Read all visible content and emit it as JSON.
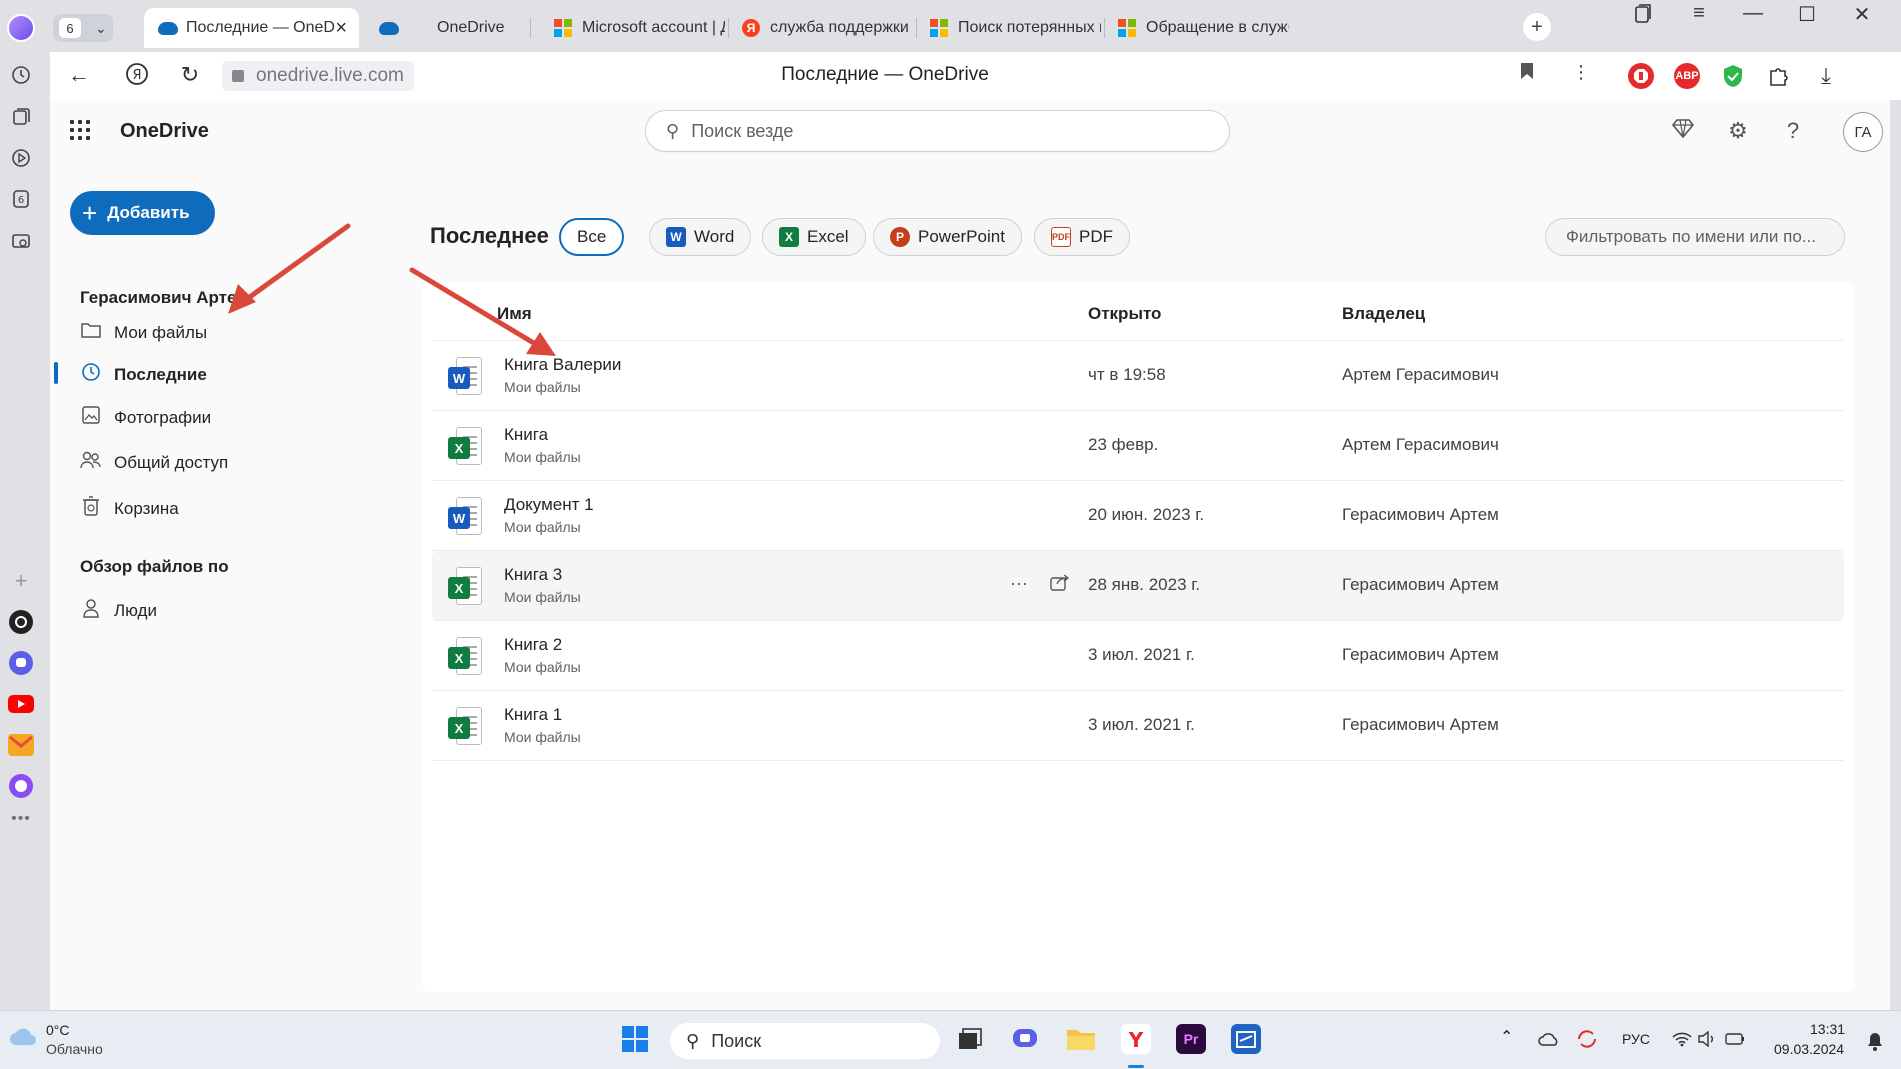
{
  "browser": {
    "tab_count": "6",
    "tabs": [
      {
        "title": "Последние — OneD",
        "favicon": "onedrive-icon"
      },
      {
        "title": "OneDrive",
        "favicon": "onedrive-icon"
      },
      {
        "title": "Microsoft account | Дом",
        "favicon": "microsoft-logo"
      },
      {
        "title": "служба поддержки On",
        "favicon": "yandex-icon"
      },
      {
        "title": "Поиск потерянных или",
        "favicon": "microsoft-logo"
      },
      {
        "title": "Обращение в службу п",
        "favicon": "microsoft-logo"
      }
    ],
    "url": "onedrive.live.com",
    "page_title": "Последние — OneDrive",
    "extensions": {
      "abp": "ABP"
    }
  },
  "app": {
    "brand": "OneDrive",
    "search_placeholder": "Поиск везде",
    "user_initials": "ГА"
  },
  "nav": {
    "add_label": "Добавить",
    "account_name": "Герасимович Артем",
    "items": [
      {
        "label": "Мои файлы",
        "icon": "folder-icon"
      },
      {
        "label": "Последние",
        "icon": "clock-icon"
      },
      {
        "label": "Фотографии",
        "icon": "photo-icon"
      },
      {
        "label": "Общий доступ",
        "icon": "people-icon"
      },
      {
        "label": "Корзина",
        "icon": "trash-icon"
      }
    ],
    "browse_header": "Обзор файлов по",
    "people_label": "Люди"
  },
  "main": {
    "title": "Последнее",
    "filters": [
      {
        "label": "Все"
      },
      {
        "label": "Word"
      },
      {
        "label": "Excel"
      },
      {
        "label": "PowerPoint"
      },
      {
        "label": "PDF"
      }
    ],
    "filter_placeholder": "Фильтровать по имени или по...",
    "columns": {
      "name": "Имя",
      "opened": "Открыто",
      "owner": "Владелец"
    },
    "files": [
      {
        "name": "Книга Валерии",
        "location": "Мои файлы",
        "opened": "чт в 19:58",
        "owner": "Артем Герасимович",
        "type": "word"
      },
      {
        "name": "Книга",
        "location": "Мои файлы",
        "opened": "23 февр.",
        "owner": "Артем Герасимович",
        "type": "excel"
      },
      {
        "name": "Документ 1",
        "location": "Мои файлы",
        "opened": "20 июн. 2023 г.",
        "owner": "Герасимович Артем",
        "type": "word"
      },
      {
        "name": "Книга 3",
        "location": "Мои файлы",
        "opened": "28 янв. 2023 г.",
        "owner": "Герасимович Артем",
        "type": "excel"
      },
      {
        "name": "Книга 2",
        "location": "Мои файлы",
        "opened": "3 июл. 2021 г.",
        "owner": "Герасимович Артем",
        "type": "excel"
      },
      {
        "name": "Книга 1",
        "location": "Мои файлы",
        "opened": "3 июл. 2021 г.",
        "owner": "Герасимович Артем",
        "type": "excel"
      }
    ]
  },
  "taskbar": {
    "temperature": "0°C",
    "weather": "Облачно",
    "search_label": "Поиск",
    "language": "РУС",
    "time": "13:31",
    "date": "09.03.2024"
  },
  "colors": {
    "accent": "#0f6cbd",
    "word": "#185abd",
    "excel": "#107c41",
    "powerpoint": "#c43e1c",
    "annotation_arrow": "#d9483b"
  }
}
